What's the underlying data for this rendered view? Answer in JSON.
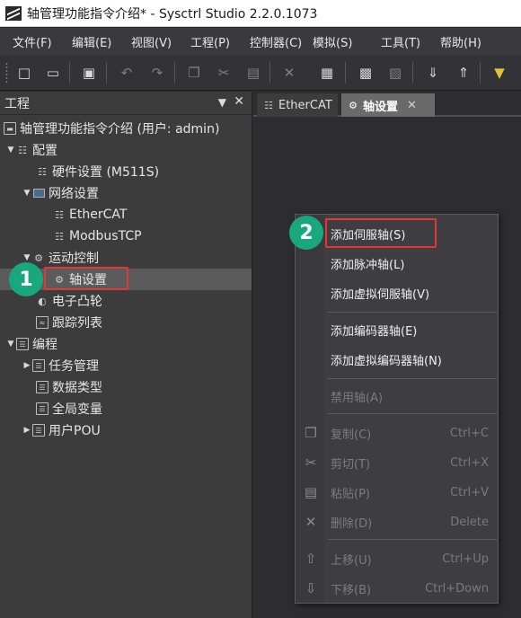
{
  "window": {
    "title": "轴管理功能指令介绍* - Sysctrl Studio 2.2.0.1073"
  },
  "menu": [
    "文件(F)",
    "编辑(E)",
    "视图(V)",
    "工程(P)",
    "控制器(C)",
    "模拟(S)",
    "工具(T)",
    "帮助(H)"
  ],
  "panel": {
    "title": "工程",
    "tree": [
      {
        "label": "轴管理功能指令介绍 (用户: admin)"
      },
      {
        "label": "配置"
      },
      {
        "label": "硬件设置 (M511S)"
      },
      {
        "label": "网络设置"
      },
      {
        "label": "EtherCAT"
      },
      {
        "label": "ModbusTCP"
      },
      {
        "label": "运动控制"
      },
      {
        "label": "轴设置"
      },
      {
        "label": "电子凸轮"
      },
      {
        "label": "跟踪列表"
      },
      {
        "label": "编程"
      },
      {
        "label": "任务管理"
      },
      {
        "label": "数据类型"
      },
      {
        "label": "全局变量"
      },
      {
        "label": "用户POU"
      }
    ]
  },
  "tabs": [
    {
      "label": "EtherCAT"
    },
    {
      "label": "轴设置"
    }
  ],
  "context_menu": {
    "items": [
      {
        "label": "添加伺服轴(S)",
        "shortcut": ""
      },
      {
        "label": "添加脉冲轴(L)",
        "shortcut": ""
      },
      {
        "label": "添加虚拟伺服轴(V)",
        "shortcut": ""
      },
      {
        "label": "添加编码器轴(E)",
        "shortcut": ""
      },
      {
        "label": "添加虚拟编码器轴(N)",
        "shortcut": ""
      },
      {
        "label": "禁用轴(A)",
        "shortcut": ""
      },
      {
        "label": "复制(C)",
        "shortcut": "Ctrl+C"
      },
      {
        "label": "剪切(T)",
        "shortcut": "Ctrl+X"
      },
      {
        "label": "粘贴(P)",
        "shortcut": "Ctrl+V"
      },
      {
        "label": "删除(D)",
        "shortcut": "Delete"
      },
      {
        "label": "上移(U)",
        "shortcut": "Ctrl+Up"
      },
      {
        "label": "下移(B)",
        "shortcut": "Ctrl+Down"
      }
    ]
  },
  "steps": [
    "1",
    "2"
  ],
  "colors": {
    "step": "#19a87e",
    "highlight": "#e03838",
    "background": "#2d2d30"
  }
}
